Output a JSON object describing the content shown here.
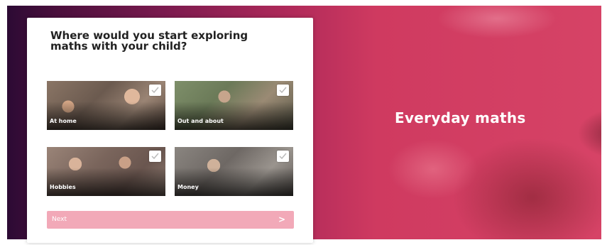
{
  "hero": {
    "title": "Everyday maths"
  },
  "card": {
    "question": "Where would you start exploring maths with your child?",
    "options": [
      {
        "label": "At home"
      },
      {
        "label": "Out and about"
      },
      {
        "label": "Hobbies"
      },
      {
        "label": "Money"
      }
    ],
    "next_label": "Next",
    "next_icon": "chevron-right-icon",
    "next_arrow_glyph": ">"
  },
  "colors": {
    "accent_pink": "#f2a9b8",
    "hero_pink": "#d64366",
    "hero_dark": "#2c0a34"
  }
}
